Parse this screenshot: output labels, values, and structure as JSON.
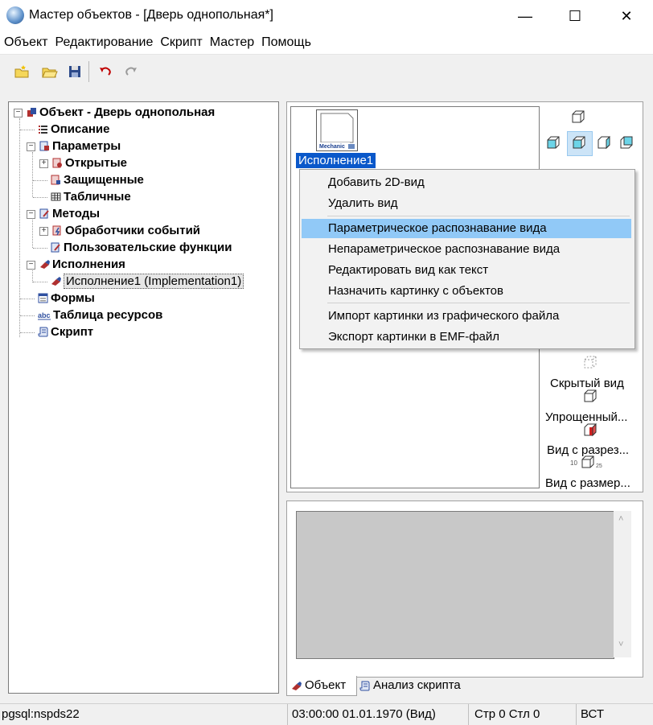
{
  "window": {
    "title": "Мастер объектов - [Дверь однопольная*]",
    "minimize": "—",
    "maximize": "☐",
    "close": "✕"
  },
  "menu": [
    "Объект",
    "Редактирование",
    "Скрипт",
    "Мастер",
    "Помощь"
  ],
  "toolbar": {
    "icons": [
      "new-folder-icon",
      "open-folder-icon",
      "save-icon",
      "undo-icon",
      "redo-icon"
    ]
  },
  "tree": {
    "root": "Объект - Дверь однопольная",
    "description": "Описание",
    "parameters": "Параметры",
    "open": "Открытые",
    "protected": "Защищенные",
    "tabular": "Табличные",
    "methods": "Методы",
    "event_handlers": "Обработчики событий",
    "user_functions": "Пользовательские функции",
    "implementations": "Исполнения",
    "implementation1": "Исполнение1 (Implementation1)",
    "forms": "Формы",
    "resources": "Таблица ресурсов",
    "script": "Скрипт"
  },
  "view": {
    "thumb_text": "Mechanic",
    "thumb_label": "Исполнение1"
  },
  "view_types": {
    "hidden": "Скрытый вид",
    "simplified": "Упрощенный...",
    "section": "Вид с разрез...",
    "dimensions": "Вид с размер...",
    "dim_text": "10",
    "dim_text2": "25"
  },
  "context_menu": {
    "add_2d": "Добавить 2D-вид",
    "delete": "Удалить вид",
    "param_recog": "Параметрическое распознавание вида",
    "nonparam_recog": "Непараметрическое распознавание вида",
    "edit_text": "Редактировать вид как текст",
    "assign_picture": "Назначить картинку с объектов",
    "import": "Импорт картинки из графического файла",
    "export": "Экспорт картинки в EMF-файл"
  },
  "tabs": {
    "object": "Объект",
    "script_analysis": "Анализ скрипта"
  },
  "status": {
    "db": "pgsql:nspds22",
    "time": "03:00:00  01.01.1970  (Вид)",
    "position": "Стр 0 Стл 0",
    "mode": "ВСТ"
  },
  "colors": {
    "selection": "#0a58ca",
    "menu_highlight": "#91c9f7"
  }
}
